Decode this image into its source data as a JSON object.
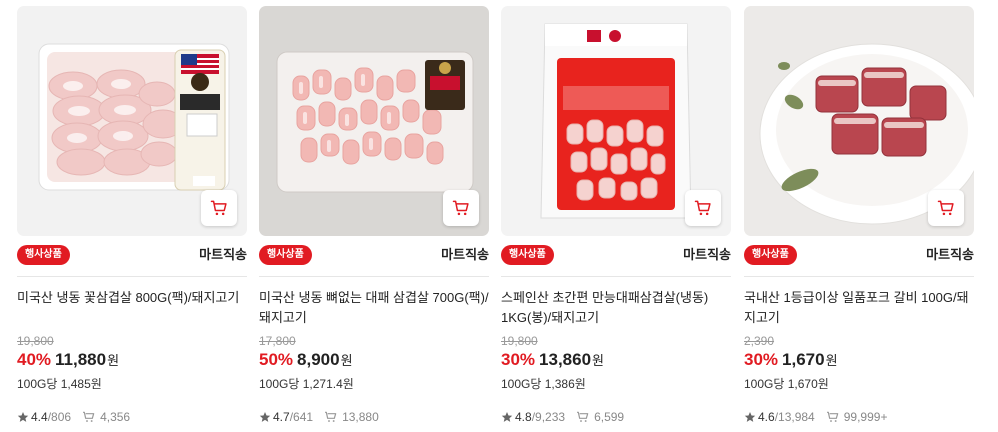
{
  "products": [
    {
      "image": "frozen-pork-belly-pack-thumb",
      "event_badge": "행사상품",
      "delivery": "마트직송",
      "name": "미국산 냉동 꽃삼겹살 800G(팩)/돼지고기",
      "original_price": "19,800",
      "discount_rate": "40%",
      "price": "11,880",
      "currency": "원",
      "unit_price": "100G당 1,485원",
      "rating": "4.4",
      "reviews": "806",
      "cart_count": "4,356"
    },
    {
      "image": "boneless-pork-belly-tray-thumb",
      "event_badge": "행사상품",
      "delivery": "마트직송",
      "name": "미국산 냉동 뼈없는 대패 삼겹살 700G(팩)/돼지고기",
      "original_price": "17,800",
      "discount_rate": "50%",
      "price": "8,900",
      "currency": "원",
      "unit_price": "100G당 1,271.4원",
      "rating": "4.7",
      "reviews": "641",
      "cart_count": "13,880"
    },
    {
      "image": "spanish-pork-belly-bag-thumb",
      "event_badge": "행사상품",
      "delivery": "마트직송",
      "name": "스페인산 초간편 만능대패삼겹살(냉동) 1KG(봉)/돼지고기",
      "original_price": "19,800",
      "discount_rate": "30%",
      "price": "13,860",
      "currency": "원",
      "unit_price": "100G당 1,386원",
      "rating": "4.8",
      "reviews": "9,233",
      "cart_count": "6,599"
    },
    {
      "image": "pork-ribs-bowl-thumb",
      "event_badge": "행사상품",
      "delivery": "마트직송",
      "name": "국내산 1등급이상 일품포크 갈비 100G/돼지고기",
      "original_price": "2,390",
      "discount_rate": "30%",
      "price": "1,670",
      "currency": "원",
      "unit_price": "100G당 1,670원",
      "rating": "4.6",
      "reviews": "13,984",
      "cart_count": "99,999+"
    }
  ],
  "icons": {
    "cart_button": "cart-icon",
    "rating": "star-icon",
    "cart_stat": "cart-count-icon"
  },
  "colors": {
    "accent": "#e11b22",
    "text": "#222222",
    "muted": "#888888"
  }
}
